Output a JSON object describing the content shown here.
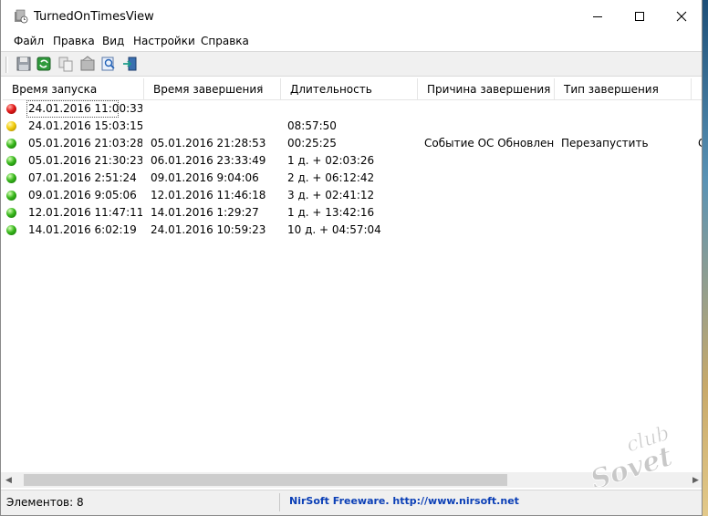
{
  "window": {
    "title": "TurnedOnTimesView"
  },
  "menu": [
    "Файл",
    "Правка",
    "Вид",
    "Настройки",
    "Справка"
  ],
  "toolbar": {
    "icons": [
      "save-icon",
      "refresh-icon",
      "copy-icon",
      "properties-icon",
      "find-icon",
      "exit-icon"
    ]
  },
  "columns": [
    "Время запуска",
    "Время завершения",
    "Длительность",
    "Причина завершения",
    "Тип завершения",
    "П"
  ],
  "rows": [
    {
      "status": "red",
      "start": "24.01.2016 11:00:33",
      "end": "",
      "duration": "",
      "reason": "",
      "type": "",
      "extra": ""
    },
    {
      "status": "yellow",
      "start": "24.01.2016 15:03:15",
      "end": "",
      "duration": "08:57:50",
      "reason": "",
      "type": "",
      "extra": ""
    },
    {
      "status": "green",
      "start": "05.01.2016 21:03:28",
      "end": "05.01.2016 21:28:53",
      "duration": "00:25:25",
      "reason": "Событие ОС Обновлен...",
      "type": "Перезапустить",
      "extra": "С"
    },
    {
      "status": "green",
      "start": "05.01.2016 21:30:23",
      "end": "06.01.2016 23:33:49",
      "duration": "1 д. + 02:03:26",
      "reason": "",
      "type": "",
      "extra": ""
    },
    {
      "status": "green",
      "start": "07.01.2016 2:51:24",
      "end": "09.01.2016 9:04:06",
      "duration": "2 д. + 06:12:42",
      "reason": "",
      "type": "",
      "extra": ""
    },
    {
      "status": "green",
      "start": "09.01.2016 9:05:06",
      "end": "12.01.2016 11:46:18",
      "duration": "3 д. + 02:41:12",
      "reason": "",
      "type": "",
      "extra": ""
    },
    {
      "status": "green",
      "start": "12.01.2016 11:47:11",
      "end": "14.01.2016 1:29:27",
      "duration": "1 д. + 13:42:16",
      "reason": "",
      "type": "",
      "extra": ""
    },
    {
      "status": "green",
      "start": "14.01.2016 6:02:19",
      "end": "24.01.2016 10:59:23",
      "duration": "10 д. + 04:57:04",
      "reason": "",
      "type": "",
      "extra": ""
    }
  ],
  "statusbar": {
    "count": "Элементов: 8",
    "link": "NirSoft Freeware.  http://www.nirsoft.net"
  },
  "watermark": {
    "line1": "club",
    "line2": "Sovet"
  }
}
